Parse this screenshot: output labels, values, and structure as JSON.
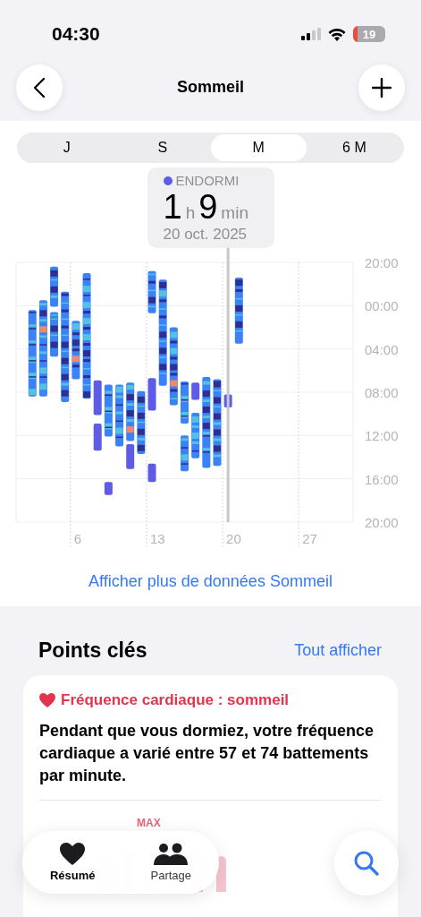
{
  "status_bar": {
    "time": "04:30",
    "battery": "19"
  },
  "header": {
    "title": "Sommeil"
  },
  "periods": [
    {
      "label": "J",
      "selected": false
    },
    {
      "label": "S",
      "selected": false
    },
    {
      "label": "M",
      "selected": true
    },
    {
      "label": "6 M",
      "selected": false
    }
  ],
  "tooltip": {
    "category": "ENDORMI",
    "color": "#5e5ce6",
    "hours": "1",
    "hours_unit": "h",
    "minutes": "9",
    "minutes_unit": "min",
    "date": "20 oct. 2025"
  },
  "chart": {
    "y_labels": [
      "20:00",
      "00:00",
      "04:00",
      "08:00",
      "12:00",
      "16:00",
      "20:00"
    ],
    "x_labels": [
      "6",
      "13",
      "20",
      "27"
    ]
  },
  "more_link": "Afficher plus de données Sommeil",
  "highlights": {
    "title": "Points clés",
    "see_all": "Tout afficher",
    "card": {
      "title": "Fréquence cardiaque : sommeil",
      "text": "Pendant que vous dormiez, votre fréquence cardiaque a varié entre 57 et 74 battements par minute.",
      "chart_label": "MAX"
    }
  },
  "tab_bar": {
    "tabs": [
      {
        "label": "Résumé",
        "selected": true
      },
      {
        "label": "Partage",
        "selected": false
      }
    ]
  }
}
